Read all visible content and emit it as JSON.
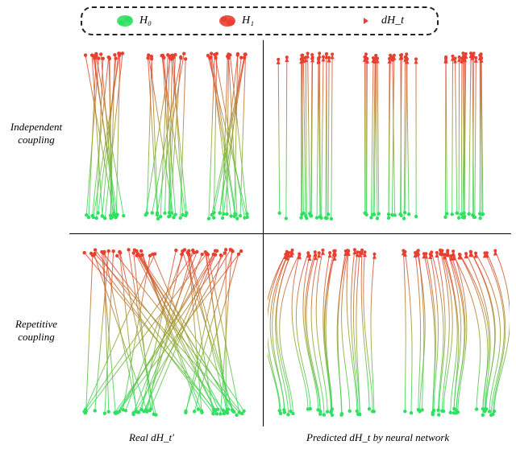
{
  "legend": {
    "h0": "H₀",
    "h1": "H₁",
    "dht": "dH_t"
  },
  "rows": {
    "top": "Independent\ncoupling",
    "bottom": "Repetitive\ncoupling"
  },
  "cols": {
    "left_prefix": "Real ",
    "left_sym": "dH_t′",
    "right_prefix": "Predicted ",
    "right_sym": "dH_t",
    "right_suffix": " by neural network"
  },
  "chart_data": {
    "type": "diagram",
    "note": "Four qualitative panels showing vector-field / flow trajectories from green bottom clusters (H0) to red top clusters (H1). Top row = independent coupling; bottom row = repetitive coupling. Left column = real dH_t'; right column = neural-network-predicted dH_t.",
    "panels": [
      {
        "row": "independent",
        "col": "real",
        "clusters": 3,
        "style": "crossing-straight"
      },
      {
        "row": "independent",
        "col": "predicted",
        "clusters": 3,
        "style": "near-vertical"
      },
      {
        "row": "repetitive",
        "col": "real",
        "clusters": 2,
        "style": "heavy-crossing"
      },
      {
        "row": "repetitive",
        "col": "predicted",
        "clusters": 2,
        "style": "s-curves"
      }
    ],
    "colors": {
      "h0": "#30e060",
      "h1": "#e84030",
      "path_start": "#30e060",
      "path_end": "#e84030"
    }
  }
}
